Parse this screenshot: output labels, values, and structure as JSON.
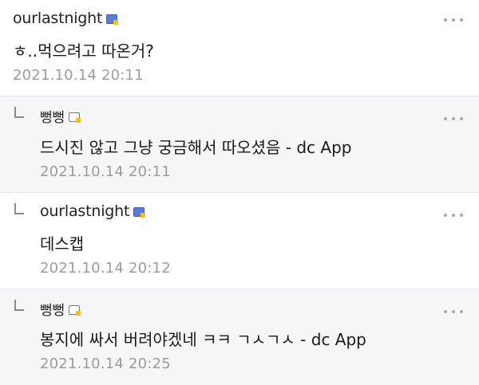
{
  "comments": [
    {
      "nickname": "ourlastnight",
      "text": "ㅎ..먹으려고 따온거?",
      "date": "2021.10.14 20:11"
    },
    {
      "nickname": "뻥뻥",
      "text": "드시진 않고 그냥 궁금해서 따오셨음 - dc App",
      "date": "2021.10.14 20:11"
    },
    {
      "nickname": "ourlastnight",
      "text": "데스캡",
      "date": "2021.10.14 20:12"
    },
    {
      "nickname": "뻥뻥",
      "text": "봉지에 싸서 버려야겠네 ㅋㅋ ㄱㅅㄱㅅ - dc App",
      "date": "2021.10.14 20:25"
    }
  ],
  "icons": {
    "reply_indent": "reply-arrow-icon",
    "fixed_member": "fixed-member-badge-icon",
    "half_member": "half-member-badge-icon",
    "more": "more-dots-icon"
  },
  "colors": {
    "reply_background": "#f6f6f8",
    "date_text": "#9c9c9c",
    "badge_blue": "#5a7bd6",
    "badge_yellow": "#f0c21a"
  }
}
